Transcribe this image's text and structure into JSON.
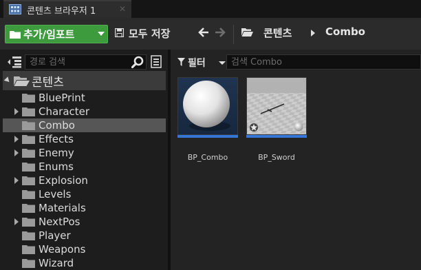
{
  "tab": {
    "title": "콘텐츠 브라우저 1",
    "close_label": "✕"
  },
  "toolbar": {
    "add_import_label": "추가/임포트",
    "save_all_label": "모두 저장",
    "breadcrumb": {
      "root": "콘텐츠",
      "current": "Combo"
    }
  },
  "sidebar": {
    "search_placeholder": "경로 검색",
    "root_label": "콘텐츠",
    "folders": [
      {
        "label": "BluePrint",
        "expandable": false,
        "selected": false
      },
      {
        "label": "Character",
        "expandable": true,
        "selected": false
      },
      {
        "label": "Combo",
        "expandable": false,
        "selected": true
      },
      {
        "label": "Effects",
        "expandable": true,
        "selected": false
      },
      {
        "label": "Enemy",
        "expandable": true,
        "selected": false
      },
      {
        "label": "Enums",
        "expandable": false,
        "selected": false
      },
      {
        "label": "Explosion",
        "expandable": true,
        "selected": false
      },
      {
        "label": "Levels",
        "expandable": false,
        "selected": false
      },
      {
        "label": "Materials",
        "expandable": false,
        "selected": false
      },
      {
        "label": "NextPos",
        "expandable": true,
        "selected": false
      },
      {
        "label": "Player",
        "expandable": false,
        "selected": false
      },
      {
        "label": "Weapons",
        "expandable": false,
        "selected": false
      },
      {
        "label": "Wizard",
        "expandable": false,
        "selected": false
      }
    ]
  },
  "content": {
    "filter_label": "필터",
    "search_placeholder": "검색 Combo",
    "assets": [
      {
        "name": "BP_Combo",
        "icon": "sphere-thumbnail"
      },
      {
        "name": "BP_Sword",
        "icon": "sword-scene-thumbnail"
      }
    ]
  },
  "colors": {
    "accent_green": "#3d9a3d",
    "selection_bar": "#3577d9",
    "folder": "#9a9a9a"
  }
}
